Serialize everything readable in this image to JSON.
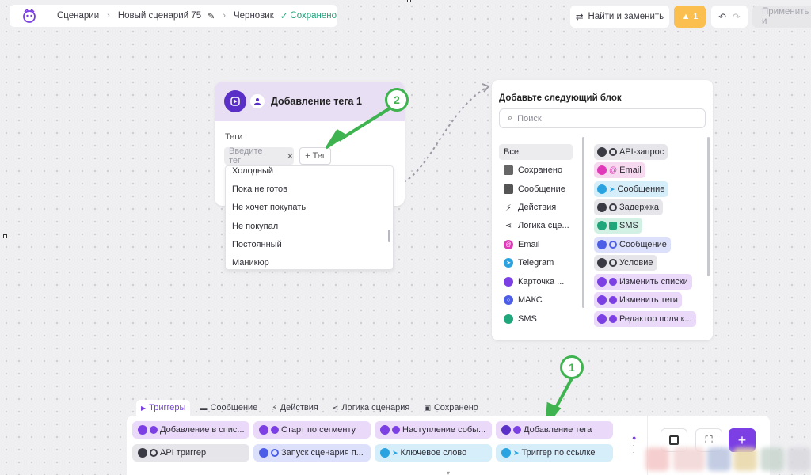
{
  "breadcrumb": {
    "scenarios": "Сценарии",
    "scenario_name": "Новый сценарий 75",
    "status_draft": "Черновик",
    "status_saved": "Сохранено"
  },
  "toolbar": {
    "find_replace": "Найти и заменить",
    "warnings_count": "1",
    "apply": "Применить и"
  },
  "node": {
    "title": "Добавление тега 1",
    "field_label": "Теги",
    "tag_placeholder": "Введите тег",
    "add_tag": "+ Тег",
    "options": [
      "Холодный",
      "Пока не готов",
      "Не хочет покупать",
      "Не покупал",
      "Постоянный",
      "Маникюр"
    ]
  },
  "panel": {
    "title": "Добавьте следующий блок",
    "search_placeholder": "Поиск",
    "categories": [
      "Все",
      "Сохранено",
      "Сообщение",
      "Действия",
      "Логика сце...",
      "Email",
      "Telegram",
      "Карточка ...",
      "МАКС",
      "SMS"
    ],
    "blocks": [
      "API-запрос",
      "Email",
      "Сообщение",
      "Задержка",
      "SMS",
      "Сообщение",
      "Условие",
      "Изменить списки",
      "Изменить теги",
      "Редактор поля к..."
    ]
  },
  "bottom": {
    "tabs": [
      "Триггеры",
      "Сообщение",
      "Действия",
      "Логика сценария",
      "Сохранено"
    ],
    "triggers": [
      "Добавление в спис...",
      "Старт по сегменту",
      "Наступление собы...",
      "Добавление тега",
      "API триггер",
      "Запуск сценария п...",
      "Ключевое слово",
      "Триггер по ссылке"
    ]
  },
  "callouts": [
    "1",
    "2"
  ],
  "colors": {
    "accent": "#7b3fe4",
    "success": "#22a37a",
    "warning": "#fbbf4f",
    "callout": "#3fb34f"
  }
}
